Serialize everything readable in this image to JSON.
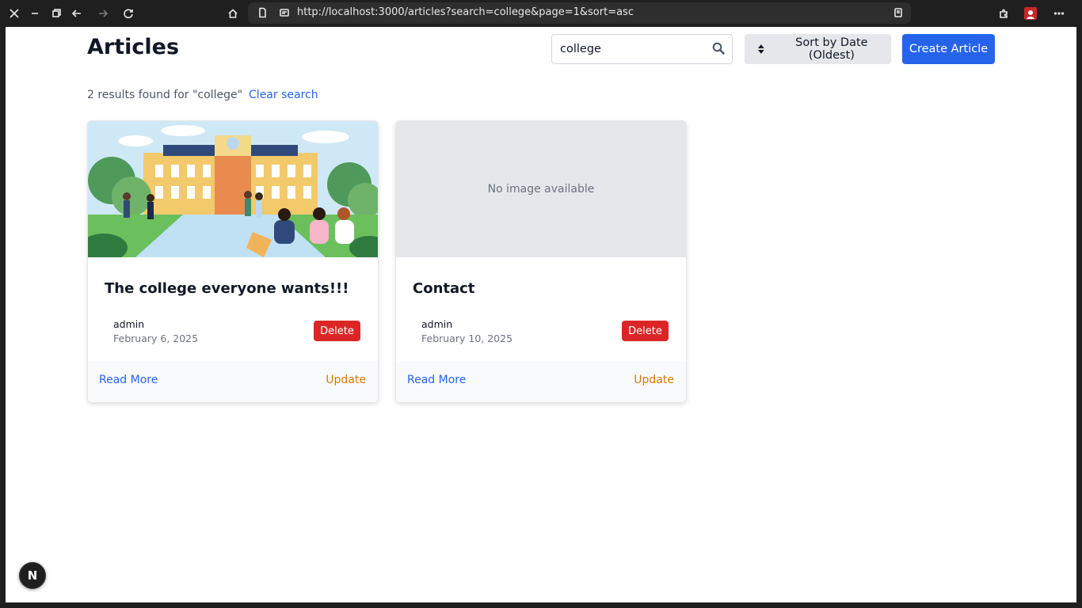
{
  "browser": {
    "url": "http://localhost:3000/articles?search=college&page=1&sort=asc"
  },
  "page": {
    "title": "Articles",
    "search_value": "college",
    "sort_label": "Sort by Date (Oldest)",
    "create_label": "Create Article",
    "results_text": "2 results found for \"college\"",
    "clear_search_label": "Clear search"
  },
  "articles": [
    {
      "title": "The college everyone wants!!!",
      "author": "admin",
      "date": "February 6, 2025",
      "has_image": true,
      "delete_label": "Delete",
      "read_more_label": "Read More",
      "update_label": "Update"
    },
    {
      "title": "Contact",
      "author": "admin",
      "date": "February 10, 2025",
      "has_image": false,
      "no_image_text": "No image available",
      "delete_label": "Delete",
      "read_more_label": "Read More",
      "update_label": "Update"
    }
  ],
  "dev_badge": {
    "letter": "N"
  },
  "colors": {
    "primary": "#2563eb",
    "danger": "#dc2626",
    "warning": "#d97706",
    "chrome_bg": "#1f1f1f"
  }
}
